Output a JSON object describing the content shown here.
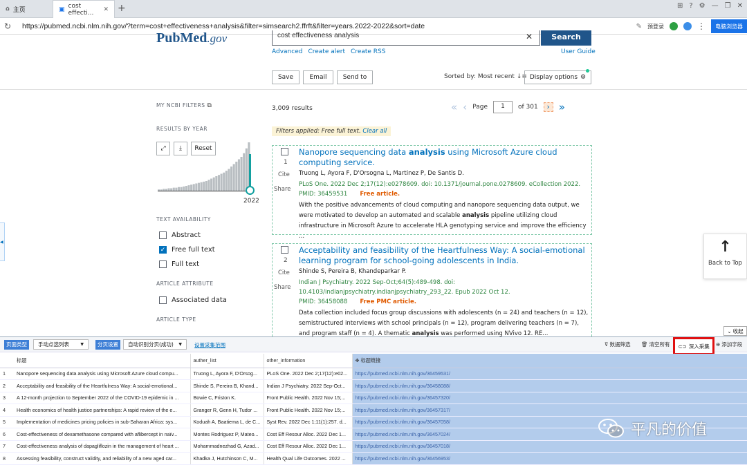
{
  "browser": {
    "tabs": [
      {
        "label": "主页"
      },
      {
        "label": "cost effecti..."
      }
    ],
    "url": "https://pubmed.ncbi.nlm.nih.gov/?term=cost+effectiveness+analysis&filter=simsearch2.ffrft&filter=years.2022-2022&sort=date",
    "login_label": "预登录",
    "browser_button": "电脑浏览器"
  },
  "pubmed": {
    "logo_left": "Pub",
    "logo_right": "Med",
    "logo_suffix": ".gov",
    "search_value": "cost effectiveness analysis",
    "search_button": "Search",
    "sublinks": [
      "Advanced",
      "Create alert",
      "Create RSS"
    ],
    "user_guide": "User Guide",
    "actions": {
      "save": "Save",
      "email": "Email",
      "send_to": "Send to"
    },
    "sorted_by": "Sorted by: Most recent",
    "display_options": "Display options",
    "sidebar": {
      "my_ncbi_filters": "MY NCBI FILTERS",
      "results_by_year": "RESULTS BY YEAR",
      "reset": "Reset",
      "year": "2022",
      "text_availability": "TEXT AVAILABILITY",
      "abstract": "Abstract",
      "free_full_text": "Free full text",
      "full_text": "Full text",
      "article_attribute": "ARTICLE ATTRIBUTE",
      "associated_data": "Associated data",
      "article_type": "ARTICLE TYPE"
    },
    "results_count": "3,009 results",
    "page_label": "Page",
    "page_value": "1",
    "of_pages": "of 301",
    "filters_applied": "Filters applied: Free full text.",
    "clear_all": "Clear all",
    "articles": [
      {
        "num": "1",
        "title_pre": "Nanopore sequencing data ",
        "title_bold": "analysis",
        "title_post": " using Microsoft Azure cloud computing service.",
        "authors": "Truong L, Ayora F, D'Orsogna L, Martinez P, De Santis D.",
        "journal": "PLoS One. 2022 Dec 2;17(12):e0278609. doi: 10.1371/journal.pone.0278609. eCollection 2022.",
        "pmid": "PMID: 36459531",
        "free": "Free article.",
        "snippet_pre": "With the positive advancements of cloud computing and nanopore sequencing data output, we were motivated to develop an automated and scalable ",
        "snippet_bold": "analysis",
        "snippet_post": " pipeline utilizing cloud infrastructure in Microsoft Azure to accelerate HLA genotyping service and improve the efficiency ..."
      },
      {
        "num": "2",
        "title_pre": "Acceptability and feasibility of the Heartfulness Way: A social-emotional learning program for school-going adolescents in India.",
        "title_bold": "",
        "title_post": "",
        "authors": "Shinde S, Pereira B, Khandeparkar P.",
        "journal": "Indian J Psychiatry. 2022 Sep-Oct;64(5):489-498. doi: 10.4103/indianjpsychiatry.indianjpsychiatry_293_22. Epub 2022 Oct 12.",
        "pmid": "PMID: 36458088",
        "free": "Free PMC article.",
        "snippet_pre": "Data collection included focus group discussions with adolescents (n = 24) and teachers (n = 12), semistructured interviews with school principals (n = 12), program delivering teachers (n = 7), and program staff (n = 4). A thematic ",
        "snippet_bold": "analysis",
        "snippet_post": " was performed using NVivo 12. RE..."
      }
    ],
    "cite": "Cite",
    "share": "Share",
    "back_to_top": "Back to Top",
    "year_bars": [
      2,
      2,
      3,
      3,
      4,
      4,
      5,
      5,
      6,
      6,
      7,
      8,
      9,
      10,
      11,
      12,
      13,
      14,
      15,
      16,
      18,
      20,
      22,
      24,
      26,
      28,
      30,
      33,
      36,
      40,
      44,
      48,
      52,
      56,
      62,
      70,
      80
    ]
  },
  "scraper": {
    "collapse": "收起",
    "page_type_label": "页面类型",
    "page_type_value": "手动点选列表",
    "paging_label": "分页设置",
    "paging_value": "自动识别分页(成功)",
    "set_range": "设置采集范围",
    "filter": "数据筛选",
    "clear": "清空所有",
    "deep": "深入采集",
    "add_field": "添加字段",
    "columns": [
      "标题",
      "auther_list",
      "other_information",
      "标题链接"
    ],
    "rows": [
      [
        "1",
        "Nanopore sequencing data analysis using Microsoft Azure cloud compu...",
        "Truong L, Ayora F, D'Orsog...",
        "PLoS One. 2022 Dec 2;17(12):e02...",
        "https://pubmed.ncbi.nlm.nih.gov/36459531/"
      ],
      [
        "2",
        "Acceptability and feasibility of the Heartfulness Way: A social-emotional...",
        "Shinde S, Pereira B, Khand...",
        "Indian J Psychiatry. 2022 Sep-Oct...",
        "https://pubmed.ncbi.nlm.nih.gov/36458088/"
      ],
      [
        "3",
        "A 12-month projection to September 2022 of the COVID-19 epidemic in ...",
        "Bowie C, Friston K.",
        "Front Public Health. 2022 Nov 15;...",
        "https://pubmed.ncbi.nlm.nih.gov/36457320/"
      ],
      [
        "4",
        "Health economics of health justice partnerships: A rapid review of the e...",
        "Granger R, Genn H, Tudor ...",
        "Front Public Health. 2022 Nov 15;...",
        "https://pubmed.ncbi.nlm.nih.gov/36457317/"
      ],
      [
        "5",
        "Implementation of medicines pricing policies in sub-Saharan Africa: sys...",
        "Koduah A, Baatiema L, de C...",
        "Syst Rev. 2022 Dec 1;11(1):257. d...",
        "https://pubmed.ncbi.nlm.nih.gov/36457058/"
      ],
      [
        "6",
        "Cost-effectiveness of dexamethasone compared with aflibercept in naïv...",
        "Montes Rodriguez P, Mateo...",
        "Cost Eff Resour Alloc. 2022 Dec 1...",
        "https://pubmed.ncbi.nlm.nih.gov/36457024/"
      ],
      [
        "7",
        "Cost-effectiveness analysis of dapagliflozin in the management of heart ...",
        "Mohammadnezhad G, Azad...",
        "Cost Eff Resour Alloc. 2022 Dec 1...",
        "https://pubmed.ncbi.nlm.nih.gov/36457018/"
      ],
      [
        "8",
        "Assessing feasibility, construct validity, and reliability of a new aged car...",
        "Khadka J, Hutchinson C, M...",
        "Health Qual Life Outcomes. 2022 ...",
        "https://pubmed.ncbi.nlm.nih.gov/36456953/"
      ]
    ]
  },
  "watermark": "平凡的价值"
}
